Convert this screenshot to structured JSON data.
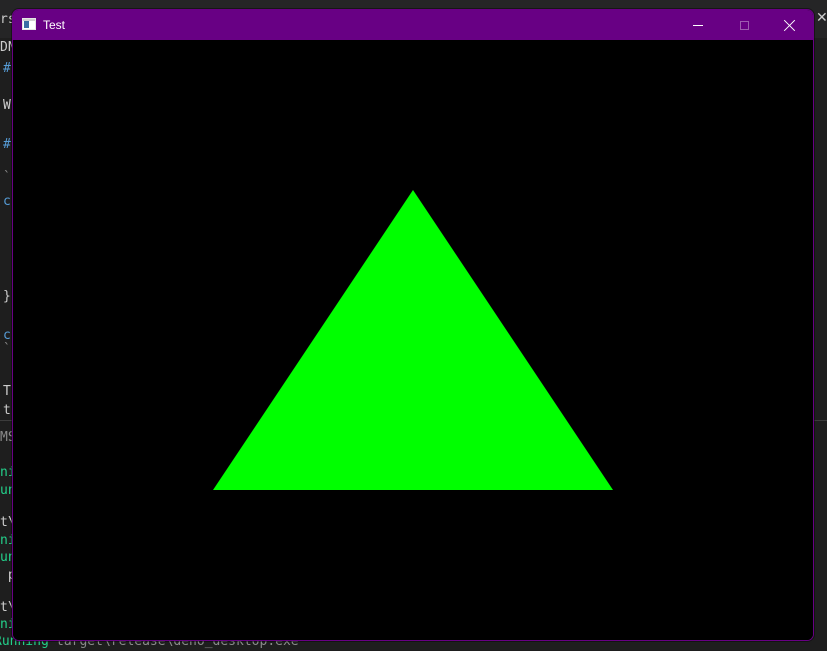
{
  "window": {
    "title": "Test",
    "accent_color": "#680084",
    "icon": "app-window-icon",
    "controls": {
      "minimize_icon": "minimize-icon",
      "maximize_icon": "maximize-icon",
      "close_icon": "close-icon"
    }
  },
  "canvas": {
    "background": "#000000",
    "shape": "triangle",
    "fill": "#00ff00"
  },
  "background_terminal": {
    "last_line_status": "Running",
    "last_line_path": "target\\release\\deno_desktop.exe"
  }
}
